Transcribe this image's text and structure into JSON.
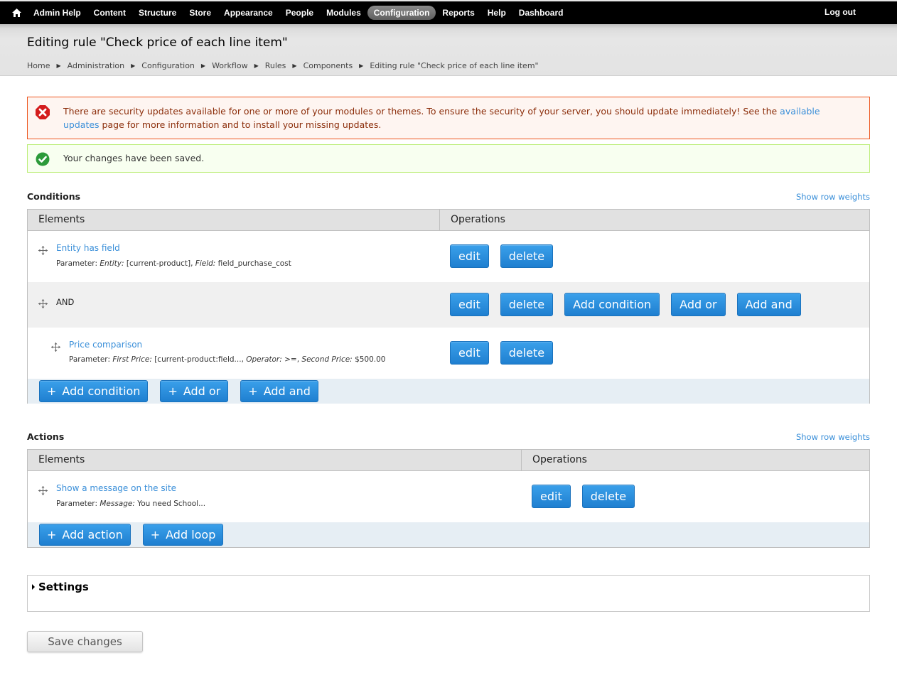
{
  "toolbar": {
    "home_icon": "home-icon",
    "items": [
      {
        "label": "Admin Help",
        "active": false
      },
      {
        "label": "Content",
        "active": false
      },
      {
        "label": "Structure",
        "active": false
      },
      {
        "label": "Store",
        "active": false
      },
      {
        "label": "Appearance",
        "active": false
      },
      {
        "label": "People",
        "active": false
      },
      {
        "label": "Modules",
        "active": false
      },
      {
        "label": "Configuration",
        "active": true
      },
      {
        "label": "Reports",
        "active": false
      },
      {
        "label": "Help",
        "active": false
      },
      {
        "label": "Dashboard",
        "active": false
      }
    ],
    "logout_label": "Log out"
  },
  "header": {
    "title": "Editing rule \"Check price of each line item\"",
    "breadcrumb": [
      "Home",
      "Administration",
      "Configuration",
      "Workflow",
      "Rules",
      "Components",
      "Editing rule \"Check price of each line item\""
    ],
    "separator": "▶"
  },
  "messages": {
    "error": {
      "icon": "error-icon",
      "text_before": "There are security updates available for one or more of your modules or themes. To ensure the security of your server, you should update immediately! See the ",
      "link": "available updates",
      "text_after": " page for more information and to install your missing updates."
    },
    "status": {
      "icon": "check-icon",
      "text": "Your changes have been saved."
    }
  },
  "conditions": {
    "title": "Conditions",
    "row_weights_label": "Show row weights",
    "headers": {
      "elements": "Elements",
      "operations": "Operations"
    },
    "rows": [
      {
        "title": "Entity has field",
        "is_link": true,
        "param_label": "Parameter:",
        "params": [
          {
            "name": "Entity:",
            "value": " [current-product], "
          },
          {
            "name": "Field:",
            "value": " field_purchase_cost"
          }
        ],
        "ops": [
          "edit",
          "delete"
        ]
      },
      {
        "title": "AND",
        "is_link": false,
        "ops": [
          "edit",
          "delete",
          "Add condition",
          "Add or",
          "Add and"
        ]
      },
      {
        "title": "Price comparison",
        "is_link": true,
        "param_label": "Parameter:",
        "params": [
          {
            "name": "First Price:",
            "value": " [current-product:field..., "
          },
          {
            "name": "Operator:",
            "value": " >=, "
          },
          {
            "name": "Second Price:",
            "value": " $500.00"
          }
        ],
        "ops": [
          "edit",
          "delete"
        ]
      }
    ],
    "footer_buttons": [
      "Add condition",
      "Add or",
      "Add and"
    ]
  },
  "actions": {
    "title": "Actions",
    "row_weights_label": "Show row weights",
    "headers": {
      "elements": "Elements",
      "operations": "Operations"
    },
    "rows": [
      {
        "title": "Show a message on the site",
        "is_link": true,
        "param_label": "Parameter:",
        "params": [
          {
            "name": "Message:",
            "value": " You need School..."
          }
        ],
        "ops": [
          "edit",
          "delete"
        ]
      }
    ],
    "footer_buttons": [
      "Add action",
      "Add loop"
    ]
  },
  "settings": {
    "label": "Settings",
    "expanded": false
  },
  "save_label": "Save changes",
  "colors": {
    "link": "#3a8fd9",
    "button_blue": "#2a8ad9",
    "error_border": "#ed541d",
    "status_border": "#bbee77"
  }
}
